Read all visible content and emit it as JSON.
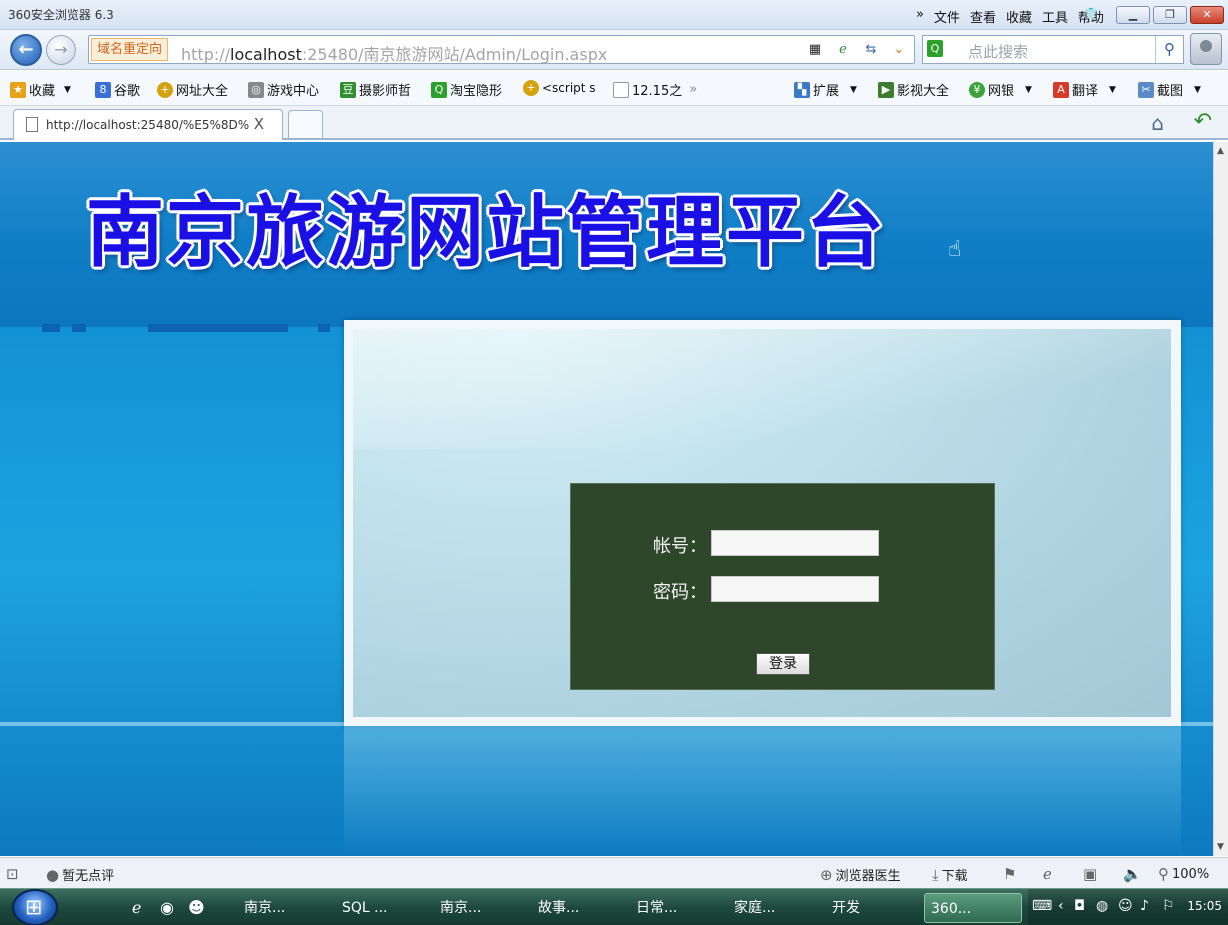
{
  "browser": {
    "app_title": "360安全浏览器 6.3",
    "title_menu": [
      "»",
      "文件",
      "查看",
      "收藏",
      "工具",
      "帮助"
    ],
    "redirect_tag": "域名重定向",
    "url_prefix": "http://",
    "url_host": "localhost",
    "url_rest": ":25480/南京旅游网站/Admin/Login.aspx",
    "search_placeholder": "点此搜索",
    "favorites": [
      {
        "label": "收藏",
        "icon": "star-icon",
        "color": "#e8a21a"
      },
      {
        "label": "谷歌",
        "icon": "google-icon",
        "color": "#3b6fd8"
      },
      {
        "label": "网址大全",
        "icon": "plus-icon",
        "color": "#d4a20d"
      },
      {
        "label": "游戏中心",
        "icon": "gamepad-icon",
        "color": "#888888"
      },
      {
        "label": "摄影师哲",
        "icon": "douban-icon",
        "color": "#2f8f2f"
      },
      {
        "label": "淘宝隐形",
        "icon": "search-icon",
        "color": "#2aa12a"
      },
      {
        "label": "<script s",
        "icon": "plus-icon",
        "color": "#d4a20d"
      },
      {
        "label": "12.15之",
        "icon": "page-icon",
        "color": "#999999"
      }
    ],
    "favorites_more": "»",
    "right_tools": [
      {
        "label": "扩展",
        "icon": "extension-icon"
      },
      {
        "label": "影视大全",
        "icon": "video-icon"
      },
      {
        "label": "网银",
        "icon": "bank-icon"
      },
      {
        "label": "翻译",
        "icon": "translate-icon"
      },
      {
        "label": "截图",
        "icon": "screenshot-icon"
      }
    ],
    "tab_title": "http://localhost:25480/%E5%8D%",
    "tab_close": "X"
  },
  "page": {
    "site_title": "南京旅游网站管理平台",
    "account_label": "帐号：",
    "password_label": "密码：",
    "account_value": "",
    "password_value": "",
    "login_button": "登录",
    "colors": {
      "title": "#1a0fe5",
      "login_box": "#2e4629",
      "background": "#1190d4"
    }
  },
  "status": {
    "rating": "暂无点评",
    "doctor": "浏览器医生",
    "download": "下载",
    "zoom": "100%"
  },
  "taskbar": {
    "items": [
      "南京...",
      "SQL ...",
      "南京...",
      "故事...",
      "日常...",
      "家庭...",
      "开发",
      "360..."
    ],
    "clock": "15:05"
  }
}
